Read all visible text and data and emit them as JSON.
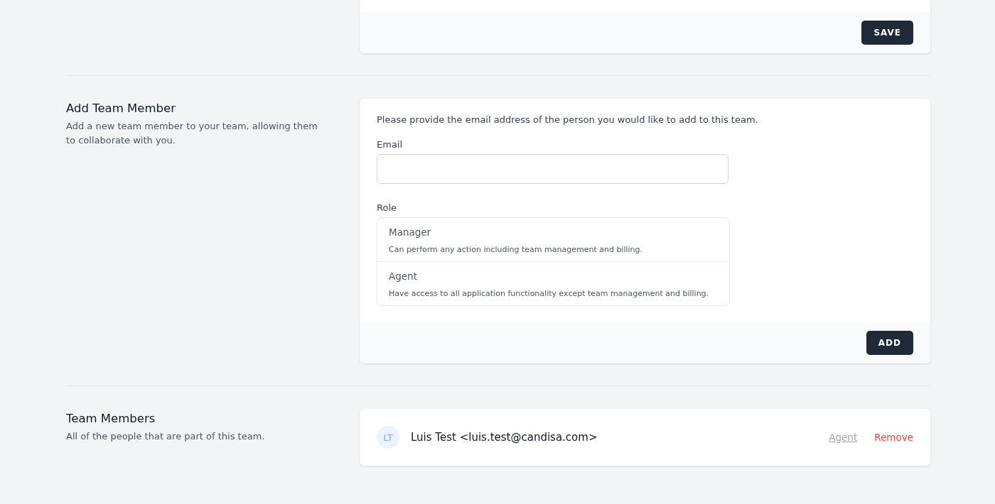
{
  "top_card": {
    "button": "SAVE"
  },
  "add_member": {
    "title": "Add Team Member",
    "description": "Add a new team member to your team, allowing them to collaborate with you.",
    "intro": "Please provide the email address of the person you would like to add to this team.",
    "email_label": "Email",
    "role_label": "Role",
    "roles": [
      {
        "name": "Manager",
        "description": "Can perform any action including team management and billing."
      },
      {
        "name": "Agent",
        "description": "Have access to all application functionality except team management and billing."
      }
    ],
    "button": "ADD"
  },
  "team_members": {
    "title": "Team Members",
    "description": "All of the people that are part of this team.",
    "members": [
      {
        "initials": "LT",
        "name": "Luis Test <luis.test@candisa.com>",
        "role": "Agent",
        "action": "Remove"
      }
    ]
  }
}
